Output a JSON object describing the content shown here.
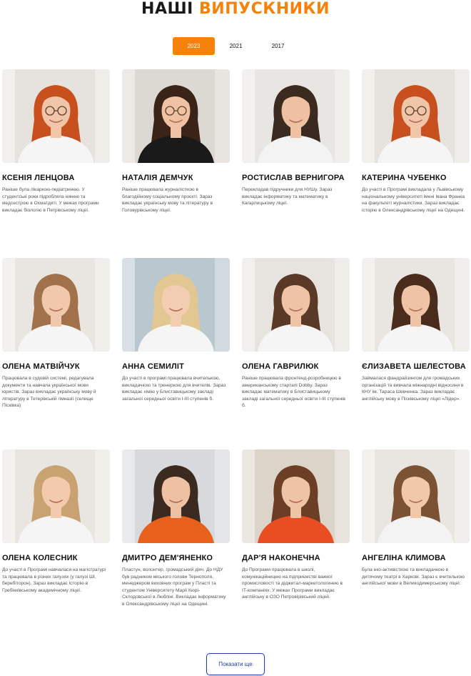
{
  "header": {
    "title_main": "НАШІ",
    "title_accent": "ВИПУСКНИКИ"
  },
  "tabs": [
    {
      "label": "2023",
      "active": true
    },
    {
      "label": "2021",
      "active": false
    },
    {
      "label": "2017",
      "active": false
    }
  ],
  "graduates": [
    {
      "name": "КСЕНІЯ ЛЕНЦОВА",
      "description": "Раніше була лікаркою-педіатринею. У студентські роки підробляла нянею та медсестрою в Охматдиті. У межах програми викладає біологію в Петрівському ліцеї."
    },
    {
      "name": "НАТАЛІЯ ДЕМЧУК",
      "description": "Раніше працювала журналісткою в благодійному соціальному проєкті. Зараз викладає українську мову та літературу в Головурівському ліцеї."
    },
    {
      "name": "РОСТИСЛАВ ВЕРНИГОРА",
      "description": "Перекладав підручники для НУШу. Зараз викладає інформатику та математику в Кагарлицькому ліцеї."
    },
    {
      "name": "КАТЕРИНА ЧУБЕНКО",
      "description": "До участі в Програмі викладала у Львівському національному університеті імені Івана Франка на факультеті журналістики. Зараз викладає історію в Олександрівському ліцеї на Одещині."
    },
    {
      "name": "ОЛЕНА МАТВІЙЧУК",
      "description": "Працювала в судовій системі, редагувала документи та навчала української мови юристів. Зараз викладає українську мову й літературу в Тетерівській гімназії (селище Пісківка)"
    },
    {
      "name": "АННА СЕМИЛІТ",
      "description": "До участі в програмі працювала вчителькою, викладачкою та тренеркою для вчителів. Зараз викладає хімію у Блиставицькому закладі загальної середньої освіти І-ІІІ ступенів б."
    },
    {
      "name": "ОЛЕНА ГАВРИЛЮК",
      "description": "Раніше працювала фронтенд-розробницею в американському стартапі Dobby. Зараз викладає математику в Блиставицькому закладі загальної середньої освіти І-ІІІ ступенів б."
    },
    {
      "name": "ЄЛИЗАВЕТА ШЕЛЕСТОВА",
      "description": "Займалася фандрайзингом для громадських організацій та вивчала міжнародні відносини в КНУ ім. Тараса Шевченка. Зараз викладає англійську мову в Пісківському ліцеї «Лідер»."
    },
    {
      "name": "ОЛЕНА КОЛЕСНИК",
      "description": "До участі в Програмі навчалася на магістратурі та працювала в різних галузях (у галузі ШІ, беребіторон). Зараз викладає історію в Гребінківському академічному ліцеї."
    },
    {
      "name": "ДМИТРО ДЕМ'ЯНЕНКО",
      "description": "Пластун, волонтер, громадський діяч. До НДУ був радником міського голови Тернополя, менеджером виховних програм у Пласті та студентом Університету Марії Кюрі-Склодовської в Любліні. Викладає інформатику в Олександрівському ліцеї на Одещині."
    },
    {
      "name": "ДАР'Я НАКОНЕЧНА",
      "description": "До Програми працювала в школі, комунікаційницею на підприємстві важкої промисловості та діджитал-маркетологинею в ІТ-компаніях. У межах Програми викладає англійську в ОЗО Петровірівський ліцей."
    },
    {
      "name": "АНГЕЛІНА КЛИМОВА",
      "description": "Була еко-активісткою та викладачкою в дитячому театрі в Харкові. Зараз є вчителькою англійської мови в Великодимерському ліцеї."
    }
  ],
  "photos": [
    {
      "hair": "#c8501e",
      "skin": "#f1c6a8",
      "bg": "#e6e3de",
      "shirt": "#f5f5f5",
      "glasses": true
    },
    {
      "hair": "#3a2418",
      "skin": "#efc2a4",
      "bg": "#dcd8d2",
      "shirt": "#1a1a1a",
      "glasses": true
    },
    {
      "hair": "#3b2a1f",
      "skin": "#eec1a2",
      "bg": "#e8e6e2",
      "shirt": "#f3f3f3",
      "glasses": false
    },
    {
      "hair": "#c8501e",
      "skin": "#f1c6a8",
      "bg": "#e6e3de",
      "shirt": "#f5f5f5",
      "glasses": true
    },
    {
      "hair": "#a0714a",
      "skin": "#f0c8ab",
      "bg": "#e9e6e1",
      "shirt": "#f5f5f5",
      "glasses": false
    },
    {
      "hair": "#e2c792",
      "skin": "#f3cdb1",
      "bg": "#b9c7cf",
      "shirt": "#f5f5f5",
      "glasses": false
    },
    {
      "hair": "#5a3a27",
      "skin": "#efc3a5",
      "bg": "#e7e4df",
      "shirt": "#f5f5f5",
      "glasses": false
    },
    {
      "hair": "#4a2c1c",
      "skin": "#efc4a6",
      "bg": "#e9e6e1",
      "shirt": "#f5f5f5",
      "glasses": false
    },
    {
      "hair": "#c9a271",
      "skin": "#f2cbae",
      "bg": "#e9e6e1",
      "shirt": "#f5f5f5",
      "glasses": false
    },
    {
      "hair": "#3b2a1f",
      "skin": "#eec1a2",
      "bg": "#d7d9dc",
      "shirt": "#e8611c",
      "glasses": false
    },
    {
      "hair": "#6b3e25",
      "skin": "#efc3a5",
      "bg": "#dcd4c9",
      "shirt": "#e94e22",
      "glasses": false
    },
    {
      "hair": "#7b5233",
      "skin": "#f1c8aa",
      "bg": "#e9e6e1",
      "shirt": "#f3f3f3",
      "glasses": false
    }
  ],
  "load_more_label": "Показати ще",
  "colors": {
    "accent": "#f7820b",
    "button_border": "#1f3fae"
  }
}
